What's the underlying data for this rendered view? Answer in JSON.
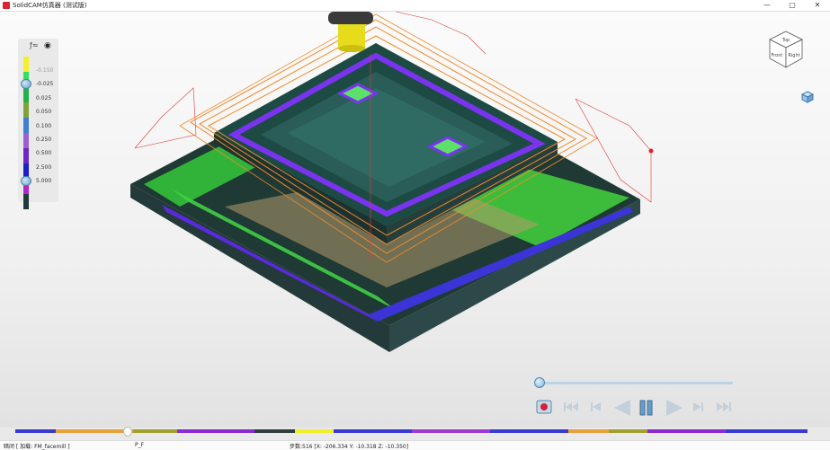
{
  "window": {
    "title": "SolidCAM仿真器 (测试版)",
    "controls": [
      "—",
      "▢",
      "✕"
    ]
  },
  "legend": {
    "header_icon": "deviation-icon",
    "eye_icon": "eye-icon",
    "labels": [
      "-0.150",
      "-0.025",
      "0.025",
      "0.050",
      "0.100",
      "0.250",
      "0.500",
      "2.500",
      "5.000"
    ],
    "colors": [
      "#f3ef2a",
      "#2fe060",
      "#22b04a",
      "#7fa33a",
      "#3f7fd4",
      "#9b5fd0",
      "#6b28c8",
      "#1d1dc9",
      "#b326c8",
      "#1f3a3a"
    ]
  },
  "navcube": {
    "faces": [
      "Top",
      "Front",
      "Right"
    ]
  },
  "playback": {
    "position": 0.0,
    "buttons": [
      "record",
      "first",
      "previous",
      "reverse",
      "pause",
      "play",
      "next",
      "last"
    ]
  },
  "timeline": {
    "position": 0.14,
    "segments": [
      {
        "color": "#3a3ad0",
        "w": 45
      },
      {
        "color": "#e7a13a",
        "w": 87
      },
      {
        "color": "#9ea12e",
        "w": 50
      },
      {
        "color": "#8a2ad0",
        "w": 86
      },
      {
        "color": "#2f3f3f",
        "w": 46
      },
      {
        "color": "#f0ef2d",
        "w": 43
      },
      {
        "color": "#3a3ad0",
        "w": 88
      },
      {
        "color": "#9e3ad0",
        "w": 88
      },
      {
        "color": "#3a3ad0",
        "w": 88
      },
      {
        "color": "#e7a13a",
        "w": 45
      },
      {
        "color": "#9ea12e",
        "w": 43
      },
      {
        "color": "#8a2ad0",
        "w": 88
      },
      {
        "color": "#3a3ad0",
        "w": 92
      }
    ]
  },
  "status": {
    "left": "暗闭 [ 加载: FM_facemill ]",
    "mid": "P_F",
    "right": "步数:516 [X: -206.334 Y: -10.318 Z: -10.350]"
  }
}
